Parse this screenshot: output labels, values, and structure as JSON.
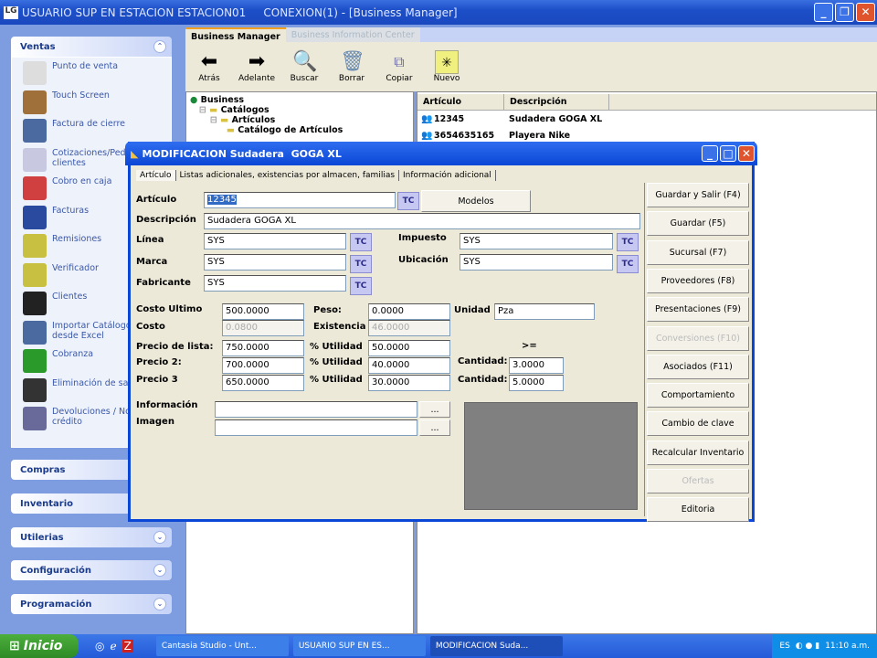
{
  "window": {
    "title": "USUARIO SUP EN ESTACION ESTACION01     CONEXION(1) - [Business Manager]",
    "logo": "LG"
  },
  "sidebar": {
    "groups": [
      {
        "label": "Ventas",
        "items": [
          "Punto de venta",
          "Touch Screen",
          "Factura de cierre",
          "Cotizaciones/Pedidos clientes",
          "Cobro en caja",
          "Facturas",
          "Remisiones",
          "Verificador",
          "Clientes",
          "Importar Catálogo Clientes desde Excel",
          "Cobranza",
          "Eliminación de saldos",
          "Devoluciones / Notas de crédito"
        ]
      },
      {
        "label": "Compras"
      },
      {
        "label": "Inventario"
      },
      {
        "label": "Utilerias"
      },
      {
        "label": "Configuración"
      },
      {
        "label": "Programación"
      }
    ]
  },
  "tabs": [
    "Business Manager",
    "Business Information Center"
  ],
  "toolbar": [
    "Atrás",
    "Adelante",
    "Buscar",
    "Borrar",
    "Copiar",
    "Nuevo"
  ],
  "tree": [
    "Business",
    "Catálogos",
    "Artículos",
    "Catálogo de Artículos"
  ],
  "list": {
    "columns": [
      "Artículo",
      "Descripción"
    ],
    "rows": [
      [
        "12345",
        "Sudadera GOGA XL"
      ],
      [
        "3654635165",
        "Playera Nike"
      ]
    ]
  },
  "dialog": {
    "title": "MODIFICACION Sudadera  GOGA XL",
    "tabs": [
      "Artículo",
      "Listas adicionales, existencias por almacen, familias",
      "Información adicional"
    ],
    "fields": {
      "articulo": {
        "label": "Artículo",
        "value": "12345"
      },
      "descripcion": {
        "label": "Descripción",
        "value": "Sudadera  GOGA XL"
      },
      "linea": {
        "label": "Línea",
        "value": "SYS"
      },
      "marca": {
        "label": "Marca",
        "value": "SYS"
      },
      "fabricante": {
        "label": "Fabricante",
        "value": "SYS"
      },
      "impuesto": {
        "label": "Impuesto",
        "value": "SYS"
      },
      "ubicacion": {
        "label": "Ubicación",
        "value": "SYS"
      },
      "costo_ultimo": {
        "label": "Costo Ultimo",
        "value": "500.0000"
      },
      "costo": {
        "label": "Costo",
        "value": "0.0800"
      },
      "precio_lista": {
        "label": "Precio de lista:",
        "value": "750.0000"
      },
      "precio2": {
        "label": "Precio 2:",
        "value": "700.0000"
      },
      "precio3": {
        "label": "Precio 3",
        "value": "650.0000"
      },
      "peso": {
        "label": "Peso:",
        "value": "0.0000"
      },
      "existencia": {
        "label": "Existencia",
        "value": "46.0000"
      },
      "utilidad1": {
        "label": "% Utilidad",
        "value": "50.0000"
      },
      "utilidad2": {
        "label": "% Utilidad",
        "value": "40.0000"
      },
      "utilidad3": {
        "label": "% Utilidad",
        "value": "30.0000"
      },
      "unidad": {
        "label": "Unidad",
        "value": "Pza"
      },
      "ge": ">=",
      "cantidad2": {
        "label": "Cantidad:",
        "value": "3.0000"
      },
      "cantidad3": {
        "label": "Cantidad:",
        "value": "5.0000"
      },
      "informacion": {
        "label": "Información",
        "value": ""
      },
      "imagen": {
        "label": "Imagen",
        "value": ""
      }
    },
    "modelos": "Modelos",
    "browse": "...",
    "lookup": "TC",
    "buttons": [
      "Guardar y Salir (F4)",
      "Guardar (F5)",
      "Sucursal (F7)",
      "Proveedores (F8)",
      "Presentaciones (F9)",
      "Conversiones (F10)",
      "Asociados (F11)",
      "Comportamiento",
      "Cambio de clave",
      "Recalcular Inventario",
      "Ofertas",
      "Editoria"
    ],
    "disabled": [
      5,
      10
    ]
  },
  "taskbar": {
    "start": "Inicio",
    "tasks": [
      "Cantasia Studio - Unt...",
      "USUARIO SUP EN ES...",
      "MODIFICACION Suda..."
    ],
    "lang": "ES",
    "clock": "11:10 a.m."
  }
}
